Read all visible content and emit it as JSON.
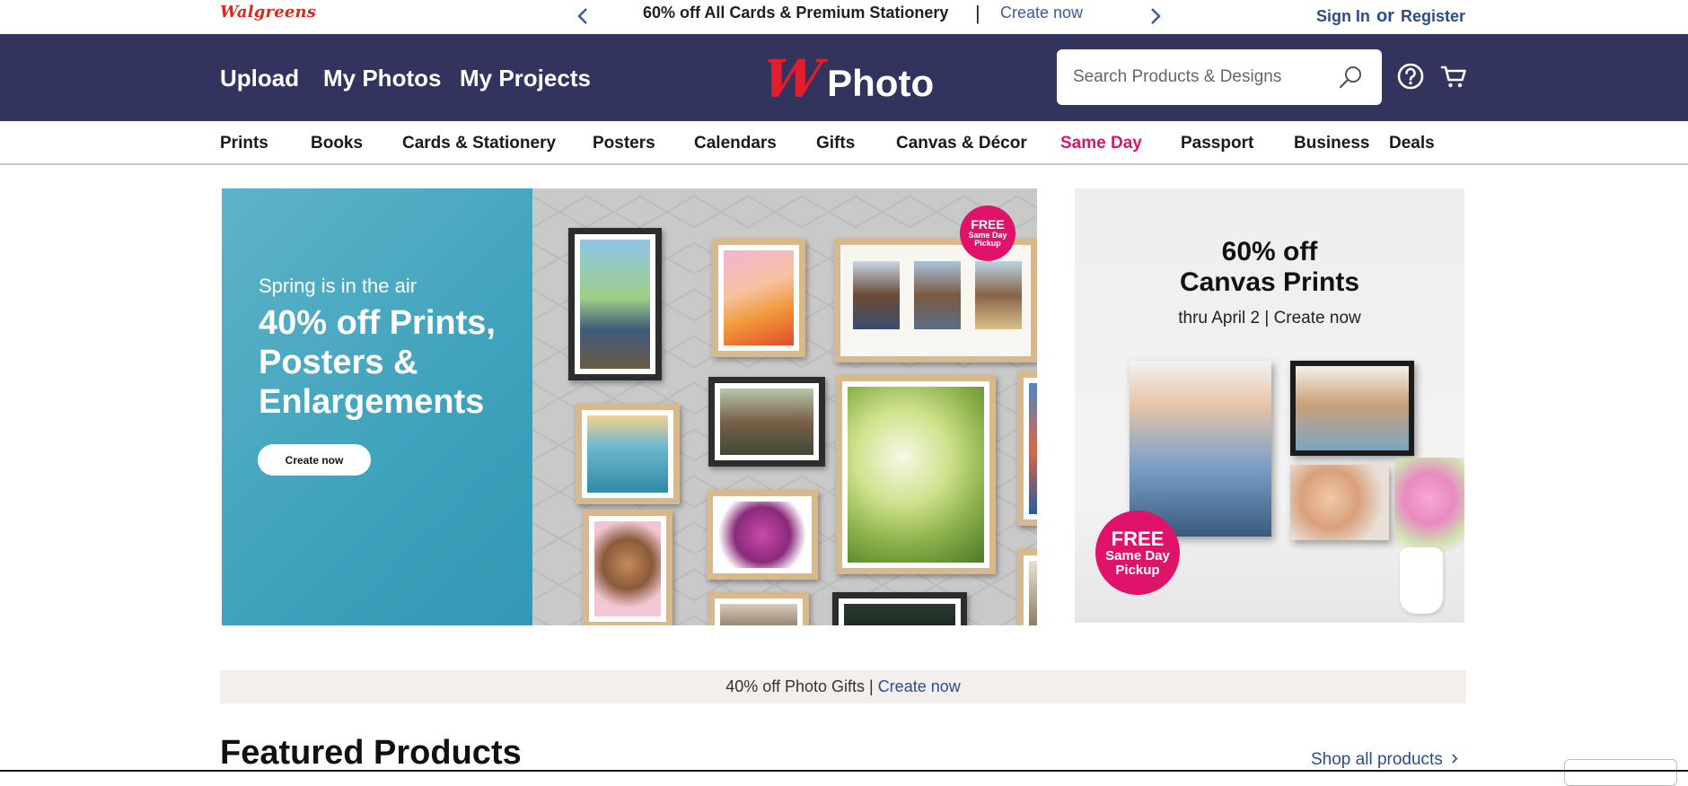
{
  "promo_bar": {
    "logo": "Walgreens",
    "message": "60% off All Cards & Premium Stationery",
    "separator": "|",
    "link": "Create now",
    "prev_icon": "chevron-left-icon",
    "next_icon": "chevron-right-icon",
    "sign_in": "Sign In",
    "or": "or",
    "register": "Register"
  },
  "header": {
    "links": [
      "Upload",
      "My Photos",
      "My Projects"
    ],
    "brand_mark": "W",
    "brand_name": "Photo",
    "search": {
      "placeholder": "Search Products & Designs",
      "value": ""
    },
    "icons": [
      "help-icon",
      "cart-icon"
    ],
    "background": "#33345e"
  },
  "nav": {
    "items": [
      "Prints",
      "Books",
      "Cards & Stationery",
      "Posters",
      "Calendars",
      "Gifts",
      "Canvas & Décor",
      "Same Day",
      "Passport",
      "Business",
      "Deals"
    ],
    "highlight_color": "#e0136b"
  },
  "hero": {
    "kicker": "Spring is in the air",
    "title": "40% off Prints, Posters & Enlargements",
    "button": "Create now",
    "badge": [
      "FREE",
      "Same Day",
      "Pickup"
    ]
  },
  "side_banner": {
    "title_line1": "60% off",
    "title_line2": "Canvas Prints",
    "subtitle": "thru April 2 | Create now",
    "badge": [
      "FREE",
      "Same Day",
      "Pickup"
    ]
  },
  "strip": {
    "text": "40% off Photo Gifts | ",
    "link": "Create now"
  },
  "featured": {
    "title": "Featured Products",
    "shop_all": "Shop all products",
    "shop_all_icon": "chevron-right-icon"
  },
  "colors": {
    "brand_red": "#e31d2b",
    "link_blue": "#2f4b8c",
    "pink": "#e0136b",
    "navy": "#33345e"
  }
}
